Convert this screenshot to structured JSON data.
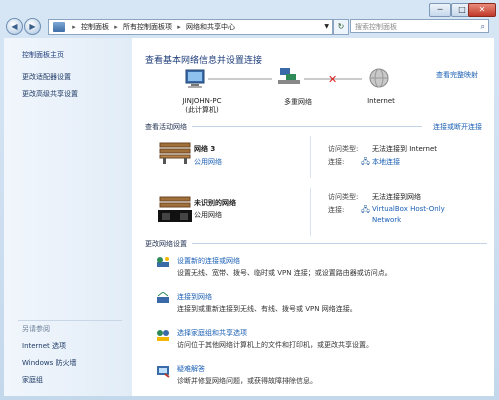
{
  "window": {
    "controls": {
      "minimize": "─",
      "maximize": "□",
      "close": "✕"
    }
  },
  "address": {
    "crumbs": [
      "控制面板",
      "所有控制面板项",
      "网络和共享中心"
    ],
    "search_placeholder": "搜索控制面板"
  },
  "sidebar": {
    "items": [
      {
        "label": "控制面板主页"
      },
      {
        "label": "更改适配器设置"
      },
      {
        "label": "更改高级共享设置"
      }
    ],
    "see_also_title": "另请参阅",
    "see_also": [
      {
        "label": "Internet 选项"
      },
      {
        "label": "Windows 防火墙"
      },
      {
        "label": "家庭组"
      }
    ]
  },
  "main": {
    "heading": "查看基本网络信息并设置连接",
    "full_map_link": "查看完整映射",
    "map": {
      "pc_name": "JINJOHN-PC",
      "pc_sub": "(此计算机)",
      "multi_net": "多重网络",
      "internet": "Internet"
    },
    "active_title": "查看活动网络",
    "connect_link": "连接或断开连接",
    "networks": [
      {
        "name": "网络  3",
        "type": "公用网络",
        "access_label": "访问类型:",
        "access_value": "无法连接到 Internet",
        "conn_label": "连接:",
        "conn_value": "本地连接"
      },
      {
        "name": "未识别的网络",
        "type": "公用网络",
        "access_label": "访问类型:",
        "access_value": "无法连接到网络",
        "conn_label": "连接:",
        "conn_value": "VirtualBox Host-Only",
        "conn_value2": "Network"
      }
    ],
    "change_title": "更改网络设置",
    "tasks": [
      {
        "title": "设置新的连接或网络",
        "desc": "设置无线、宽带、拨号、临时或 VPN 连接；或设置路由器或访问点。"
      },
      {
        "title": "连接到网络",
        "desc": "连接到或重新连接到无线、有线、拨号或 VPN 网络连接。"
      },
      {
        "title": "选择家庭组和共享选项",
        "desc": "访问位于其他网络计算机上的文件和打印机，或更改共享设置。"
      },
      {
        "title": "疑难解答",
        "desc": "诊断并修复网络问题，或获得故障排除信息。"
      }
    ]
  }
}
